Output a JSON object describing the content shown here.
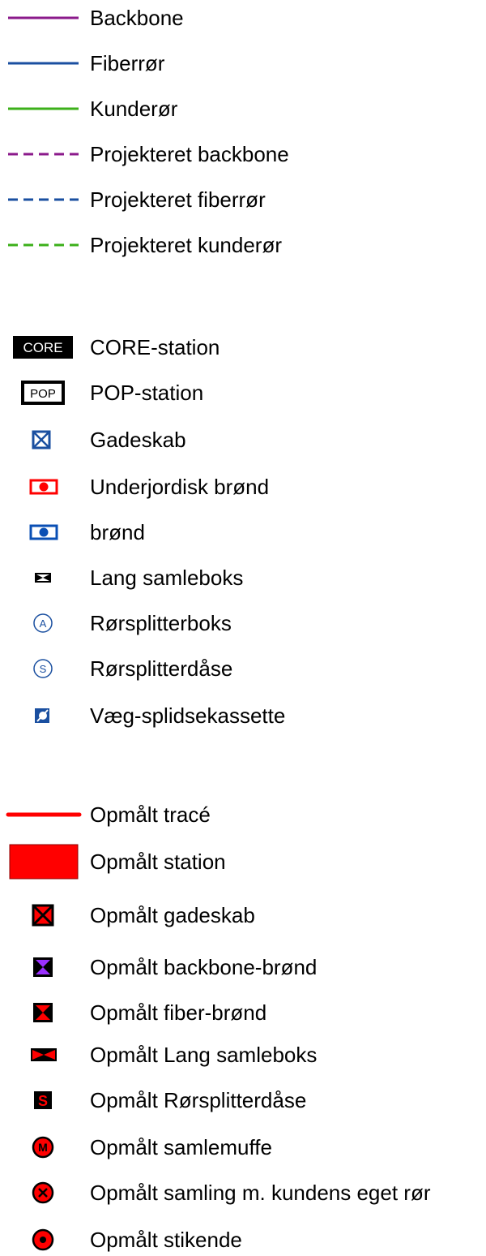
{
  "sections": {
    "lines": [
      {
        "label": "Backbone",
        "icon": "solid-purple-line-icon",
        "color": "#8B1A8B"
      },
      {
        "label": "Fiberrør",
        "icon": "solid-blue-line-icon",
        "color": "#1A4FA0"
      },
      {
        "label": "Kunderør",
        "icon": "solid-green-line-icon",
        "color": "#3CB01A"
      },
      {
        "label": "Projekteret backbone",
        "icon": "dashed-purple-line-icon",
        "color": "#8B1A8B"
      },
      {
        "label": "Projekteret fiberrør",
        "icon": "dashed-blue-line-icon",
        "color": "#1A4FA0"
      },
      {
        "label": "Projekteret kunderør",
        "icon": "dashed-green-line-icon",
        "color": "#3CB01A"
      }
    ],
    "points": [
      {
        "label": "CORE-station",
        "icon": "core-station-icon",
        "icon_text": "CORE",
        "color": "#000000"
      },
      {
        "label": "POP-station",
        "icon": "pop-station-icon",
        "icon_text": "POP",
        "color": "#000000"
      },
      {
        "label": "Gadeskab",
        "icon": "street-cabinet-icon",
        "color": "#1A4FA0"
      },
      {
        "label": "Underjordisk brønd",
        "icon": "underground-well-icon",
        "color": "#FF0000"
      },
      {
        "label": "brønd",
        "icon": "well-icon",
        "color": "#0A4FB4"
      },
      {
        "label": "Lang samleboks",
        "icon": "long-junction-box-icon",
        "color": "#000000"
      },
      {
        "label": "Rørsplitterboks",
        "icon": "pipe-splitter-box-icon",
        "icon_text": "A",
        "color": "#1A4FA0"
      },
      {
        "label": "Rørsplitterdåse",
        "icon": "pipe-splitter-can-icon",
        "icon_text": "S",
        "color": "#1A4FA0"
      },
      {
        "label": "Væg-splidsekassette",
        "icon": "wall-splice-cassette-icon",
        "color": "#1A4FA0"
      }
    ],
    "surveyed": [
      {
        "label": "Opmålt tracé",
        "icon": "surveyed-route-line-icon",
        "color": "#FF0000"
      },
      {
        "label": "Opmålt station",
        "icon": "surveyed-station-icon",
        "color": "#FF0000"
      },
      {
        "label": "Opmålt gadeskab",
        "icon": "surveyed-street-cabinet-icon",
        "color": "#FF0000"
      },
      {
        "label": "Opmålt backbone-brønd",
        "icon": "surveyed-backbone-well-icon",
        "color": "#9B30FF"
      },
      {
        "label": "Opmålt fiber-brønd",
        "icon": "surveyed-fiber-well-icon",
        "color": "#FF0000"
      },
      {
        "label": "Opmålt Lang samleboks",
        "icon": "surveyed-long-junction-box-icon",
        "color": "#FF0000"
      },
      {
        "label": "Opmålt Rørsplitterdåse",
        "icon": "surveyed-pipe-splitter-can-icon",
        "icon_text": "S",
        "color": "#FF0000"
      },
      {
        "label": "Opmålt samlemuffe",
        "icon": "surveyed-splice-sleeve-icon",
        "icon_text": "M",
        "color": "#FF0000"
      },
      {
        "label": "Opmålt samling m. kundens eget rør",
        "icon": "surveyed-joint-customer-pipe-icon",
        "color": "#FF0000"
      },
      {
        "label": "Opmålt stikende",
        "icon": "surveyed-drop-end-icon",
        "color": "#FF0000"
      }
    ]
  }
}
